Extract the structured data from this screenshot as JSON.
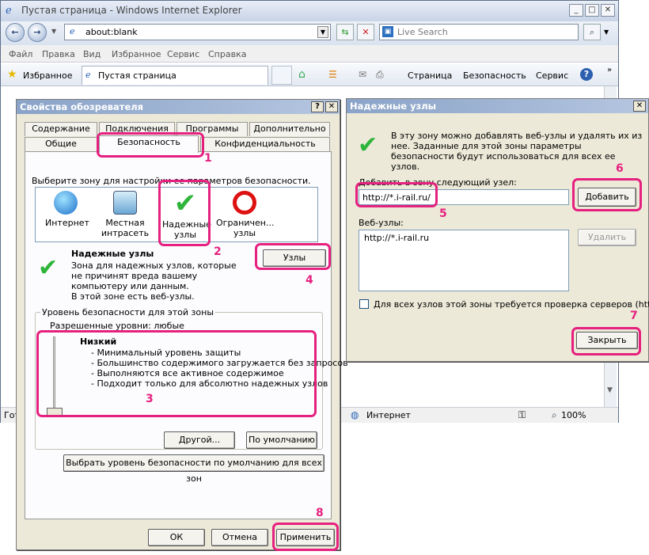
{
  "ie": {
    "title": "Пустая страница - Windows Internet Explorer",
    "address": "about:blank",
    "search_placeholder": "Live Search",
    "menu": [
      "Файл",
      "Правка",
      "Вид",
      "Избранное",
      "Сервис",
      "Справка"
    ],
    "favorites_label": "Избранное",
    "tab_title": "Пустая страница",
    "command_bar": {
      "page": "Страница",
      "security": "Безопасность",
      "tools": "Сервис"
    },
    "status_zone": "Интернет",
    "zoom": "100%",
    "status_left": "Гот"
  },
  "props": {
    "title": "Свойства обозревателя",
    "tabs_top": [
      "Содержание",
      "Подключения",
      "Программы",
      "Дополнительно"
    ],
    "tabs_bottom": [
      "Общие",
      "Безопасность",
      "Конфиденциальность"
    ],
    "zone_prompt": "Выберите зону для настройки ее параметров безопасности.",
    "zones": [
      "Интернет",
      "Местная интрасеть",
      "Надежные узлы",
      "Ограничен... узлы"
    ],
    "zone_heading": "Надежные узлы",
    "zone_desc": "Зона для надежных узлов, которые не причинят вреда вашему компьютеру или данным.",
    "zone_desc2": "В этой зоне есть веб-узлы.",
    "sites_button": "Узлы",
    "level_group": "Уровень безопасности для этой зоны",
    "allowed_levels": "Разрешенные уровни: любые",
    "level_name": "Низкий",
    "level_items": [
      "- Минимальный уровень защиты",
      "- Большинство содержимого загружается без запросов",
      "- Выполняются все активное содержимое",
      "- Подходит только для абсолютно надежных узлов"
    ],
    "custom_button": "Другой...",
    "default_button": "По умолчанию",
    "all_default_button": "Выбрать уровень безопасности по умолчанию для всех зон",
    "ok": "ОК",
    "cancel": "Отмена",
    "apply": "Применить"
  },
  "trusted": {
    "title": "Надежные узлы",
    "info": "В эту зону можно добавлять веб-узлы и удалять их из нее. Заданные для этой зоны параметры безопасности будут использоваться для всех ее узлов.",
    "add_label": "Добавить в зону следующий узел:",
    "add_value": "http://*.i-rail.ru/",
    "add_button": "Добавить",
    "sites_label": "Веб-узлы:",
    "sites": [
      "http://*.i-rail.ru"
    ],
    "remove_button": "Удалить",
    "require_https": "Для всех узлов этой зоны требуется проверка серверов (https:)",
    "close_button": "Закрыть"
  },
  "annotations": [
    "1",
    "2",
    "3",
    "4",
    "5",
    "6",
    "7",
    "8"
  ],
  "colors": {
    "annotation": "#e6207f",
    "check": "#2fb43a",
    "title_bar": "#8aa3c8"
  }
}
